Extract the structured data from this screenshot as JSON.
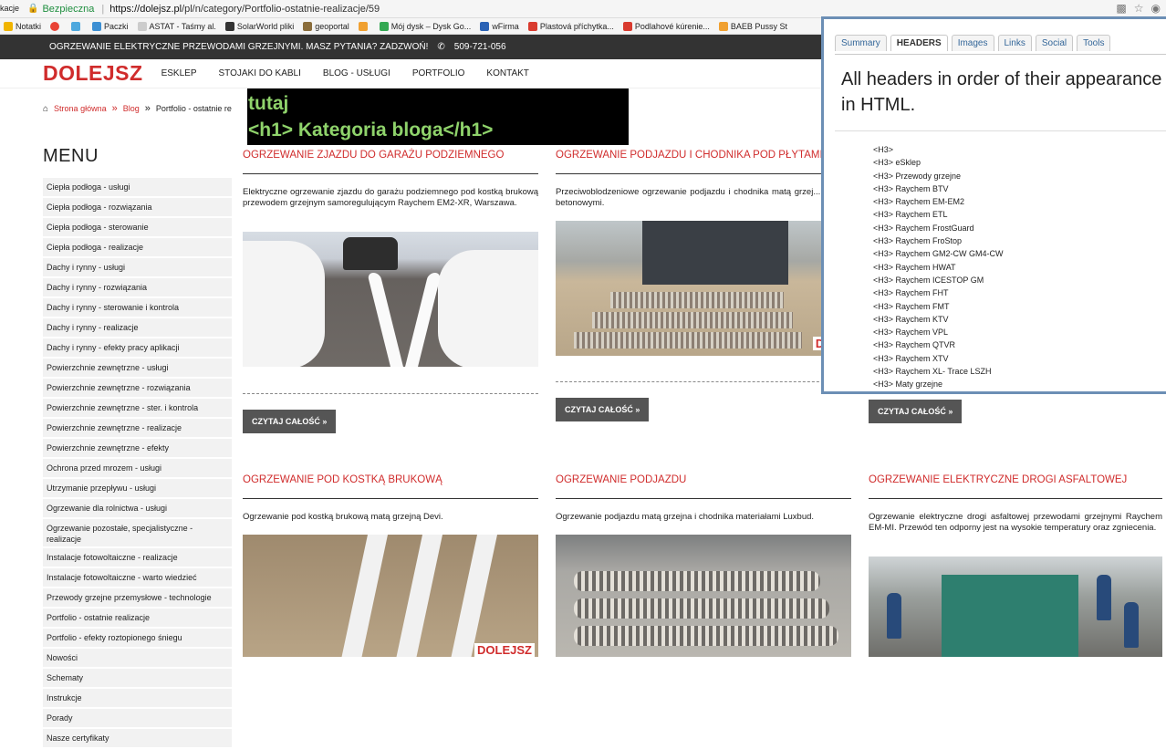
{
  "browser": {
    "left_fragment": "kacje",
    "secure_label": "Bezpieczna",
    "url_host": "https://dolejsz.pl",
    "url_path": "/pl/n/category/Portfolio-ostatnie-realizacje/59",
    "bookmarks": [
      "Notatki",
      "Paczki",
      "ASTAT - Taśmy al.",
      "SolarWorld pliki",
      "geoportal",
      "Mój dysk – Dysk Go...",
      "wFirma",
      "Plastová příchytka...",
      "Podlahové kúrenie...",
      "BAEB Pussy St"
    ],
    "bookmark_colors": [
      "#f0b400",
      "#4ea8de",
      "#cccccc",
      "#333333",
      "#8a6d3b",
      "#f0a030",
      "#2a62b5",
      "#d93b2f",
      "#d93b2f",
      "#222222"
    ]
  },
  "site": {
    "topbar_msg": "OGRZEWANIE ELEKTRYCZNE PRZEWODAMI GRZEJNYMI. MASZ PYTANIA? ZADZWOŃ!",
    "phone_icon": "phone-icon",
    "phone": "509-721-056",
    "logo": "DOLEJSZ",
    "nav": [
      "ESKLEP",
      "STOJAKI DO KABLI",
      "BLOG - USŁUGI",
      "PORTFOLIO",
      "KONTAKT"
    ],
    "crumbs": {
      "home": "Strona główna",
      "blog": "Blog",
      "current": "Portfolio - ostatnie re"
    },
    "overlay": {
      "line1": "tutaj",
      "line2": "<h1> Kategoria bloga</h1>"
    },
    "menu_title": "MENU",
    "menu": [
      "Ciepła podłoga - usługi",
      "Ciepła podłoga - rozwiązania",
      "Ciepła podłoga - sterowanie",
      "Ciepła podłoga - realizacje",
      "Dachy i rynny - usługi",
      "Dachy i rynny - rozwiązania",
      "Dachy i rynny - sterowanie i kontrola",
      "Dachy i rynny - realizacje",
      "Dachy i rynny - efekty pracy aplikacji",
      "Powierzchnie zewnętrzne - usługi",
      "Powierzchnie zewnętrzne - rozwiązania",
      "Powierzchnie zewnętrzne - ster. i kontrola",
      "Powierzchnie zewnętrzne - realizacje",
      "Powierzchnie zewnętrzne - efekty",
      "Ochrona przed mrozem - usługi",
      "Utrzymanie przepływu - usługi",
      "Ogrzewanie dla rolnictwa - usługi",
      "Ogrzewanie pozostałe, specjalistyczne - realizacje",
      "Instalacje fotowoltaiczne - realizacje",
      "Instalacje fotowoltaiczne - warto wiedzieć",
      "Przewody grzejne przemysłowe - technologie",
      "Portfolio - ostatnie realizacje",
      "Portfolio - efekty roztopionego śniegu",
      "Nowości",
      "Schematy",
      "Instrukcje",
      "Porady",
      "Nasze certyfikaty"
    ],
    "posts": [
      {
        "title": "OGRZEWANIE ZJAZDU DO GARAŻU PODZIEMNEGO",
        "desc": "Elektryczne ogrzewanie zjazdu do garażu podziemnego pod kostką brukową przewodem grzejnym samoregulującym Raychem EM2-XR, Warszawa.",
        "button": "CZYTAJ CAŁOŚĆ »"
      },
      {
        "title": "OGRZEWANIE PODJAZDU I CHODNIKA POD PŁYTAMI",
        "desc": "Przeciwoblodzeniowe ogrzewanie podjazdu i chodnika matą grzej... płytami betonowymi.",
        "button": "CZYTAJ CAŁOŚĆ »",
        "img_logo": "DOLE"
      },
      {
        "title": "",
        "desc": "",
        "button": "CZYTAJ CAŁOŚĆ »"
      },
      {
        "title": "OGRZEWANIE POD KOSTKĄ BRUKOWĄ",
        "desc": "Ogrzewanie pod kostką brukową matą grzejną Devi.",
        "img_logo": "DOLEJSZ"
      },
      {
        "title": "OGRZEWANIE PODJAZDU",
        "desc": "Ogrzewanie podjazdu matą grzejna i chodnika materiałami Luxbud."
      },
      {
        "title": "OGRZEWANIE ELEKTRYCZNE DROGI ASFALTOWEJ",
        "desc": "Ogrzewanie elektryczne drogi asfaltowej przewodami grzejnymi Raychem EM-MI. Przewód ten odporny jest na wysokie temperatury oraz zgniecenia."
      }
    ]
  },
  "extension": {
    "tabs": [
      "Summary",
      "HEADERS",
      "Images",
      "Links",
      "Social",
      "Tools"
    ],
    "active_tab": "HEADERS",
    "heading": "All headers in order of their appearance in HTML.",
    "headers": [
      "<H3>",
      "<H3> eSklep",
      "<H3> Przewody grzejne",
      "<H3> Raychem BTV",
      "<H3> Raychem EM-EM2",
      "<H3> Raychem ETL",
      "<H3> Raychem FrostGuard",
      "<H3> Raychem FroStop",
      "<H3> Raychem GM2-CW GM4-CW",
      "<H3> Raychem HWAT",
      "<H3> Raychem ICESTOP GM",
      "<H3> Raychem FHT",
      "<H3> Raychem FMT",
      "<H3> Raychem KTV",
      "<H3> Raychem VPL",
      "<H3> Raychem QTVR",
      "<H3> Raychem XTV",
      "<H3> Raychem XL- Trace LSZH",
      "<H3> Maty grzejne"
    ]
  },
  "colors": {
    "brand_red": "#d02c2c",
    "topbar": "#333333",
    "button": "#555555",
    "overlay_text": "#8fd36b",
    "panel_border": "#6c8fb5"
  }
}
